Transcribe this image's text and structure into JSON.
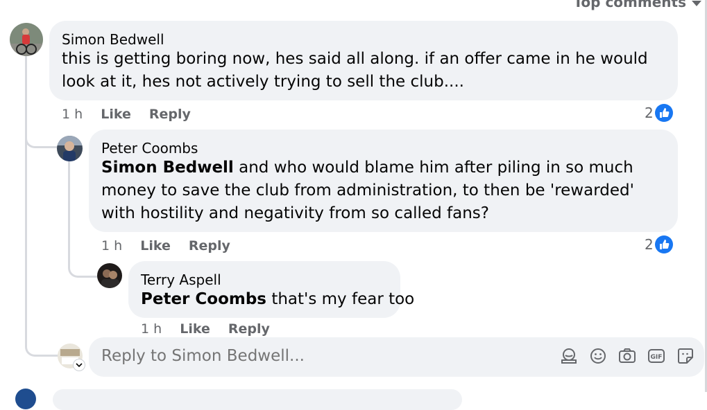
{
  "sort": {
    "label": "Top comments",
    "icon": "chevron-down-icon"
  },
  "comments": [
    {
      "author": "Simon Bedwell",
      "mention": "",
      "text": "this is getting boring now, hes said all along. if an offer came in he would look at it, hes not actively trying to sell the club....",
      "time": "1 h",
      "like_label": "Like",
      "reply_label": "Reply",
      "reaction_count": "2"
    },
    {
      "author": "Peter Coombs",
      "mention": "Simon Bedwell",
      "text": " and who would blame him after piling in so much money to save the club from administration, to then be 'rewarded' with hostility and negativity from so called fans?",
      "time": "1 h",
      "like_label": "Like",
      "reply_label": "Reply",
      "reaction_count": "2"
    },
    {
      "author": "Terry Aspell",
      "mention": "Peter Coombs",
      "text": " that's my fear too",
      "time": "1 h",
      "like_label": "Like",
      "reply_label": "Reply"
    }
  ],
  "reply_box": {
    "placeholder": "Reply to Simon Bedwell...",
    "tools": [
      "avatar-sticker-icon",
      "emoji-icon",
      "camera-icon",
      "gif-icon",
      "sticker-icon"
    ]
  },
  "colors": {
    "bubble": "#f0f2f5",
    "meta": "#65676b",
    "like_blue": "#1877f2"
  }
}
